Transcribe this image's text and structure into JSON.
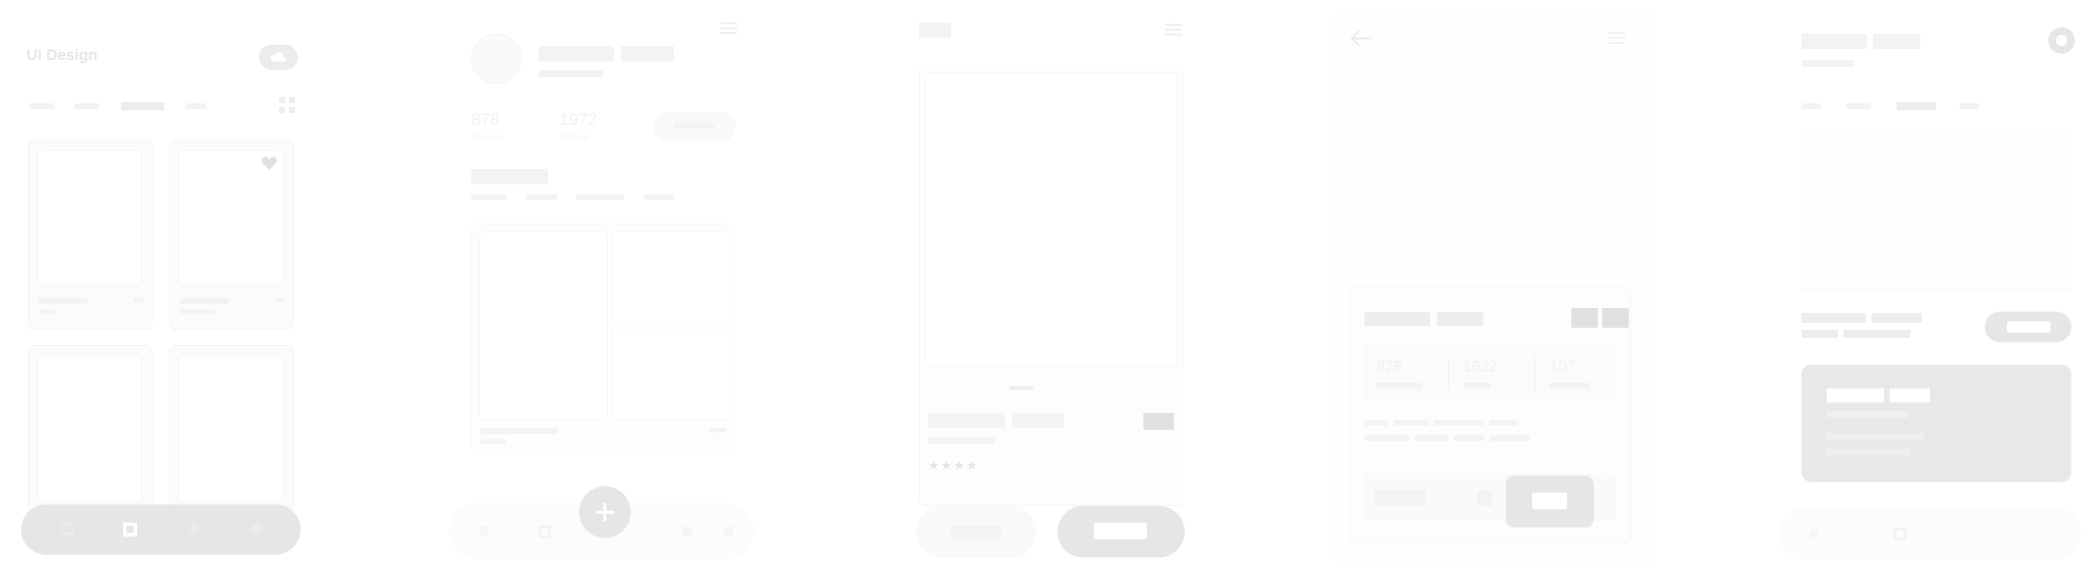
{
  "screen1": {
    "brand": "UI Design",
    "tabs": [
      "",
      "",
      "",
      ""
    ],
    "cards": [
      {
        "title": "",
        "meta": ""
      },
      {
        "title": "",
        "meta": ""
      },
      {
        "title": "",
        "meta": ""
      },
      {
        "title": "",
        "meta": ""
      }
    ]
  },
  "screen2": {
    "stats": [
      {
        "value": "878",
        "label": "Followers"
      },
      {
        "value": "1972",
        "label": "Following"
      }
    ],
    "follow_label": ""
  },
  "screen3": {
    "rating": "★★★★"
  },
  "screen4": {
    "stats": [
      {
        "value": "878",
        "label": ""
      },
      {
        "value": "1632",
        "label": ""
      },
      {
        "value": "107",
        "label": ""
      }
    ]
  },
  "screen5": {
    "subtitle": ""
  },
  "icons": {
    "heart": "heart-icon",
    "grid": "grid-icon",
    "menu": "menu-icon",
    "back": "back-arrow-icon",
    "settings": "settings-icon",
    "add": "plus-icon",
    "home": "home-icon",
    "square": "square-icon",
    "search": "search-icon"
  },
  "colors": {
    "primary_fill": "#e8e8e8",
    "accent_fill": "#ffffff"
  }
}
